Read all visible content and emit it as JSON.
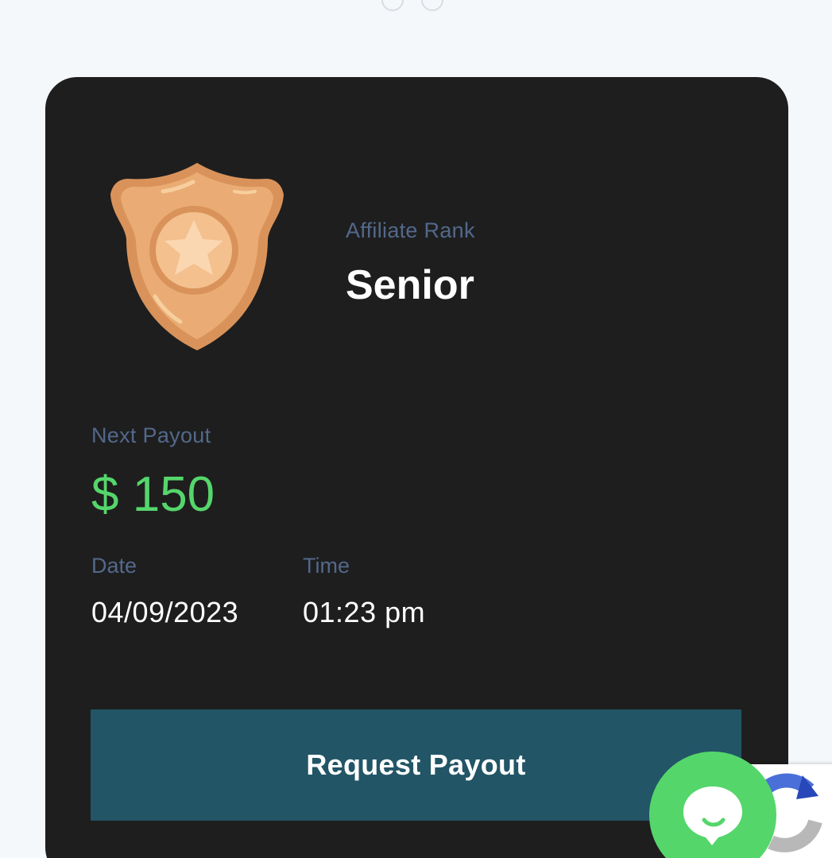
{
  "affiliate": {
    "rank_label": "Affiliate Rank",
    "rank_value": "Senior"
  },
  "payout": {
    "label": "Next Payout",
    "amount": "$ 150",
    "date_label": "Date",
    "date_value": "04/09/2023",
    "time_label": "Time",
    "time_value": "01:23 pm",
    "button_label": "Request Payout"
  },
  "icons": {
    "badge": "shield-star-badge-icon",
    "chat": "chat-bubble-icon",
    "recaptcha": "recaptcha-icon"
  },
  "colors": {
    "card_background": "#1e1e1f",
    "label": "#53688a",
    "amount": "#55d66b",
    "button": "#225566",
    "chat_button": "#55d66b",
    "badge": "#e5a66f"
  }
}
